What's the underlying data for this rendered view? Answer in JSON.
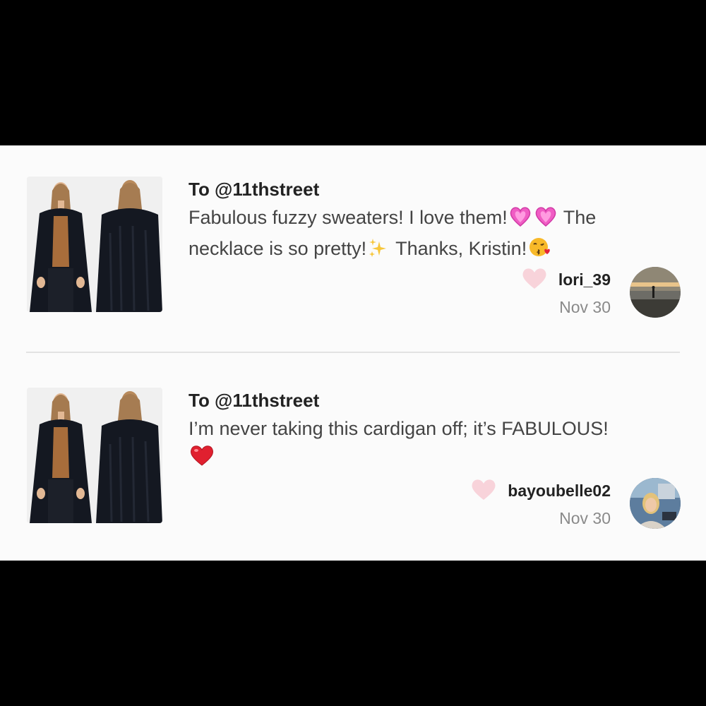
{
  "reviews": [
    {
      "recipient": "To @11thstreet",
      "comment_parts": [
        "Fabulous fuzzy sweaters! I love them!",
        "The",
        "necklace is so pretty!",
        "Thanks, Kristin!"
      ],
      "emojis": [
        "sparkling-heart",
        "sparkling-heart",
        "sparkles",
        "kissing-face"
      ],
      "username": "lori_39",
      "date": "Nov 30"
    },
    {
      "recipient": "To @11thstreet",
      "comment_parts": [
        "I’m never taking this cardigan off; it’s FABULOUS!"
      ],
      "emojis": [
        "red-heart"
      ],
      "username": "bayoubelle02",
      "date": "Nov 30"
    }
  ],
  "colors": {
    "page_bg": "#000000",
    "card_bg": "#fbfbfb",
    "like_heart": "#f8d3da",
    "text_primary": "#222222",
    "text_secondary": "#8a8a8a"
  }
}
